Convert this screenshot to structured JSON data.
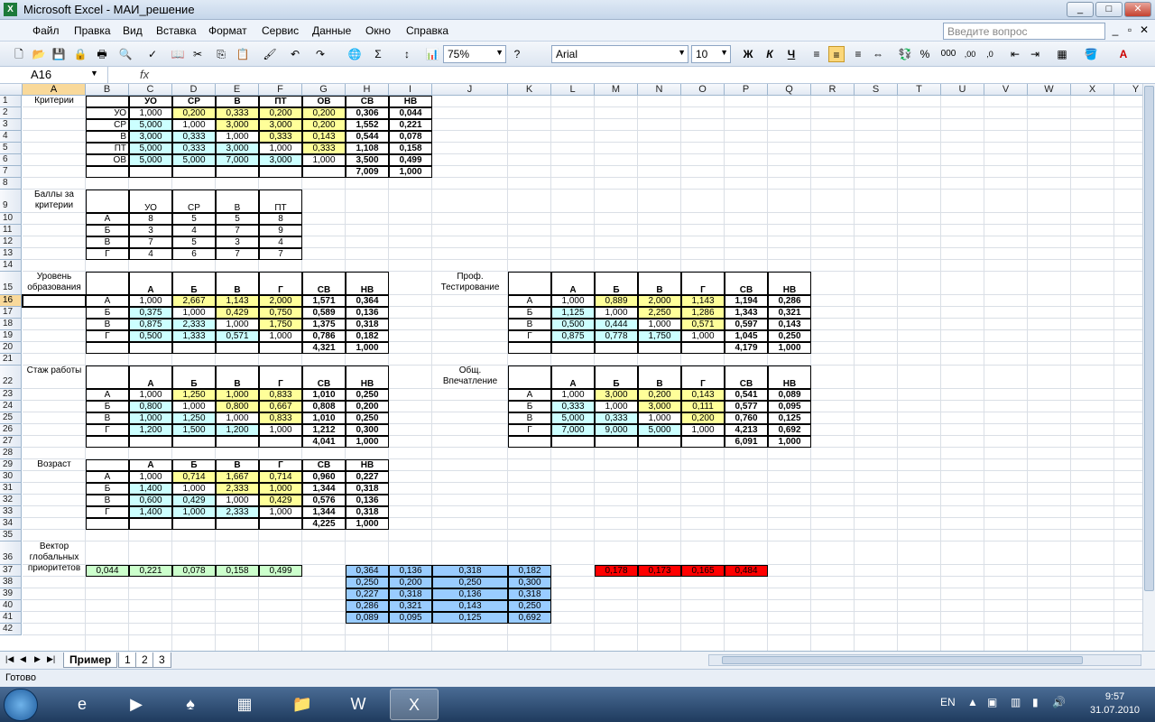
{
  "window": {
    "title": "Microsoft Excel - МАИ_решение",
    "min": "_",
    "max": "□",
    "close": "✕"
  },
  "menu": [
    "Файл",
    "Правка",
    "Вид",
    "Вставка",
    "Формат",
    "Сервис",
    "Данные",
    "Окно",
    "Справка"
  ],
  "help_placeholder": "Введите вопрос",
  "toolbar": {
    "zoom": "75%",
    "font": "Arial",
    "font_size": "10",
    "bold": "Ж",
    "italic": "К",
    "underline": "Ч",
    "percent": "%",
    "thousands": "000",
    "sum": "Σ"
  },
  "formula_bar": {
    "name_box": "A16",
    "fx": "fx",
    "content": ""
  },
  "columns": [
    "A",
    "B",
    "C",
    "D",
    "E",
    "F",
    "G",
    "H",
    "I",
    "J",
    "K",
    "L",
    "M",
    "N",
    "O",
    "P",
    "Q",
    "R",
    "S",
    "T",
    "U",
    "V",
    "W",
    "X",
    "Y"
  ],
  "rows": 42,
  "labels": {
    "criteria": "Критерии",
    "scores": "Баллы за критерии",
    "education": "Уровень образования",
    "experience": "Стаж работы",
    "age": "Возраст",
    "vector": "Вектор глобальных приоритетов",
    "testing": "Проф. Тестирование",
    "impression": "Общ. Впечатление"
  },
  "criteria_matrix": {
    "headers": [
      "УО",
      "СР",
      "В",
      "ПТ",
      "ОВ",
      "СВ",
      "НВ"
    ],
    "rows": [
      {
        "name": "УО",
        "cells": [
          "1,000",
          "0,200",
          "0,333",
          "0,200",
          "0,200"
        ],
        "sv": "0,306",
        "nv": "0,044"
      },
      {
        "name": "СР",
        "cells": [
          "5,000",
          "1,000",
          "3,000",
          "3,000",
          "0,200"
        ],
        "sv": "1,552",
        "nv": "0,221"
      },
      {
        "name": "В",
        "cells": [
          "3,000",
          "0,333",
          "1,000",
          "0,333",
          "0,143"
        ],
        "sv": "0,544",
        "nv": "0,078"
      },
      {
        "name": "ПТ",
        "cells": [
          "5,000",
          "0,333",
          "3,000",
          "1,000",
          "0,333"
        ],
        "sv": "1,108",
        "nv": "0,158"
      },
      {
        "name": "ОВ",
        "cells": [
          "5,000",
          "5,000",
          "7,000",
          "3,000",
          "1,000"
        ],
        "sv": "3,500",
        "nv": "0,499"
      }
    ],
    "sum_sv": "7,009",
    "sum_nv": "1,000"
  },
  "scores_table": {
    "headers": [
      "УО",
      "СР",
      "В",
      "ПТ"
    ],
    "rows": [
      {
        "name": "А",
        "cells": [
          "8",
          "5",
          "5",
          "8"
        ]
      },
      {
        "name": "Б",
        "cells": [
          "3",
          "4",
          "7",
          "9"
        ]
      },
      {
        "name": "В",
        "cells": [
          "7",
          "5",
          "3",
          "4"
        ]
      },
      {
        "name": "Г",
        "cells": [
          "4",
          "6",
          "7",
          "7"
        ]
      }
    ]
  },
  "alt_headers": [
    "А",
    "Б",
    "В",
    "Г",
    "СВ",
    "НВ"
  ],
  "education_matrix": {
    "rows": [
      {
        "name": "А",
        "cells": [
          "1,000",
          "2,667",
          "1,143",
          "2,000"
        ],
        "sv": "1,571",
        "nv": "0,364"
      },
      {
        "name": "Б",
        "cells": [
          "0,375",
          "1,000",
          "0,429",
          "0,750"
        ],
        "sv": "0,589",
        "nv": "0,136"
      },
      {
        "name": "В",
        "cells": [
          "0,875",
          "2,333",
          "1,000",
          "1,750"
        ],
        "sv": "1,375",
        "nv": "0,318"
      },
      {
        "name": "Г",
        "cells": [
          "0,500",
          "1,333",
          "0,571",
          "1,000"
        ],
        "sv": "0,786",
        "nv": "0,182"
      }
    ],
    "sum_sv": "4,321",
    "sum_nv": "1,000"
  },
  "experience_matrix": {
    "rows": [
      {
        "name": "А",
        "cells": [
          "1,000",
          "1,250",
          "1,000",
          "0,833"
        ],
        "sv": "1,010",
        "nv": "0,250"
      },
      {
        "name": "Б",
        "cells": [
          "0,800",
          "1,000",
          "0,800",
          "0,667"
        ],
        "sv": "0,808",
        "nv": "0,200"
      },
      {
        "name": "В",
        "cells": [
          "1,000",
          "1,250",
          "1,000",
          "0,833"
        ],
        "sv": "1,010",
        "nv": "0,250"
      },
      {
        "name": "Г",
        "cells": [
          "1,200",
          "1,500",
          "1,200",
          "1,000"
        ],
        "sv": "1,212",
        "nv": "0,300"
      }
    ],
    "sum_sv": "4,041",
    "sum_nv": "1,000"
  },
  "age_matrix": {
    "rows": [
      {
        "name": "А",
        "cells": [
          "1,000",
          "0,714",
          "1,667",
          "0,714"
        ],
        "sv": "0,960",
        "nv": "0,227"
      },
      {
        "name": "Б",
        "cells": [
          "1,400",
          "1,000",
          "2,333",
          "1,000"
        ],
        "sv": "1,344",
        "nv": "0,318"
      },
      {
        "name": "В",
        "cells": [
          "0,600",
          "0,429",
          "1,000",
          "0,429"
        ],
        "sv": "0,576",
        "nv": "0,136"
      },
      {
        "name": "Г",
        "cells": [
          "1,400",
          "1,000",
          "2,333",
          "1,000"
        ],
        "sv": "1,344",
        "nv": "0,318"
      }
    ],
    "sum_sv": "4,225",
    "sum_nv": "1,000"
  },
  "testing_matrix": {
    "rows": [
      {
        "name": "А",
        "cells": [
          "1,000",
          "0,889",
          "2,000",
          "1,143"
        ],
        "sv": "1,194",
        "nv": "0,286"
      },
      {
        "name": "Б",
        "cells": [
          "1,125",
          "1,000",
          "2,250",
          "1,286"
        ],
        "sv": "1,343",
        "nv": "0,321"
      },
      {
        "name": "В",
        "cells": [
          "0,500",
          "0,444",
          "1,000",
          "0,571"
        ],
        "sv": "0,597",
        "nv": "0,143"
      },
      {
        "name": "Г",
        "cells": [
          "0,875",
          "0,778",
          "1,750",
          "1,000"
        ],
        "sv": "1,045",
        "nv": "0,250"
      }
    ],
    "sum_sv": "4,179",
    "sum_nv": "1,000"
  },
  "impression_matrix": {
    "rows": [
      {
        "name": "А",
        "cells": [
          "1,000",
          "3,000",
          "0,200",
          "0,143"
        ],
        "sv": "0,541",
        "nv": "0,089"
      },
      {
        "name": "Б",
        "cells": [
          "0,333",
          "1,000",
          "3,000",
          "0,111"
        ],
        "sv": "0,577",
        "nv": "0,095"
      },
      {
        "name": "В",
        "cells": [
          "5,000",
          "0,333",
          "1,000",
          "0,200"
        ],
        "sv": "0,760",
        "nv": "0,125"
      },
      {
        "name": "Г",
        "cells": [
          "7,000",
          "9,000",
          "5,000",
          "1,000"
        ],
        "sv": "4,213",
        "nv": "0,692"
      }
    ],
    "sum_sv": "6,091",
    "sum_nv": "1,000"
  },
  "global_vector": [
    "0,044",
    "0,221",
    "0,078",
    "0,158",
    "0,499"
  ],
  "blue_matrix": [
    [
      "0,364",
      "0,136",
      "0,318",
      "0,182"
    ],
    [
      "0,250",
      "0,200",
      "0,250",
      "0,300"
    ],
    [
      "0,227",
      "0,318",
      "0,136",
      "0,318"
    ],
    [
      "0,286",
      "0,321",
      "0,143",
      "0,250"
    ],
    [
      "0,089",
      "0,095",
      "0,125",
      "0,692"
    ]
  ],
  "result": [
    "0,178",
    "0,173",
    "0,165",
    "0,484"
  ],
  "sheets": {
    "tabs": [
      "Пример",
      "1",
      "2",
      "3"
    ],
    "active": "Пример"
  },
  "status": "Готово",
  "taskbar": {
    "lang": "EN",
    "time": "9:57",
    "date": "31.07.2010"
  },
  "colors": {
    "yellow": "#ffff99",
    "cyan": "#ccffff",
    "green": "#ccffcc",
    "blue": "#99ccff",
    "red": "#ff0000"
  }
}
